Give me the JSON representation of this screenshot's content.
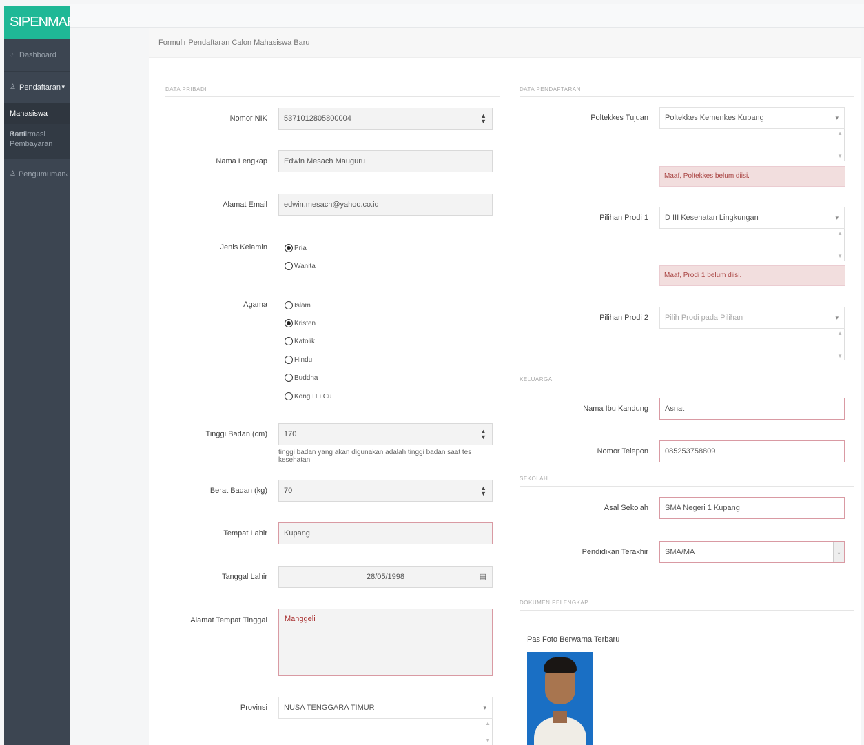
{
  "app": {
    "brand": "SIPENMARU"
  },
  "sidebar": {
    "dashboard": "Dashboard",
    "pendaftaran": "Pendaftaran",
    "sub_items": [
      "Mahasiswa Baru",
      "Konfirmasi Pembayaran"
    ],
    "pengumuman": "Pengumuman"
  },
  "panel": {
    "title": "Formulir Pendaftaran Calon Mahasiswa Baru"
  },
  "sections": {
    "data_pribadi": "DATA PRIBADI",
    "data_pendaftaran": "DATA PENDAFTARAN",
    "keluarga": "KELUARGA",
    "sekolah": "SEKOLAH",
    "dokumen": "DOKUMEN PELENGKAP"
  },
  "form": {
    "nik": {
      "label": "Nomor NIK",
      "value": "5371012805800004"
    },
    "nama": {
      "label": "Nama Lengkap",
      "value": "Edwin Mesach Mauguru"
    },
    "email": {
      "label": "Alamat Email",
      "value": "edwin.mesach@yahoo.co.id"
    },
    "jenis_kelamin": {
      "label": "Jenis Kelamin",
      "options": [
        "Pria",
        "Wanita"
      ],
      "selected": "Pria"
    },
    "agama": {
      "label": "Agama",
      "options": [
        "Islam",
        "Kristen",
        "Katolik",
        "Hindu",
        "Buddha",
        "Kong Hu Cu"
      ],
      "selected": "Kristen"
    },
    "tinggi": {
      "label": "Tinggi Badan (cm)",
      "value": "170",
      "help": "tinggi badan yang akan digunakan adalah tinggi badan saat tes kesehatan"
    },
    "berat": {
      "label": "Berat Badan (kg)",
      "value": "70"
    },
    "tempat_lahir": {
      "label": "Tempat Lahir",
      "value": "Kupang"
    },
    "tanggal_lahir": {
      "label": "Tanggal Lahir",
      "value": "28/05/1998"
    },
    "alamat": {
      "label": "Alamat Tempat Tinggal",
      "value": "Manggeli"
    },
    "provinsi": {
      "label": "Provinsi",
      "value": "NUSA TENGGARA TIMUR"
    }
  },
  "pendaftaran": {
    "poltekkes": {
      "label": "Poltekkes Tujuan",
      "value": "Poltekkes Kemenkes Kupang",
      "error": "Maaf, Poltekkes belum diisi."
    },
    "prodi1": {
      "label": "Pilihan Prodi 1",
      "value": "D III Kesehatan Lingkungan",
      "error": "Maaf, Prodi 1 belum diisi."
    },
    "prodi2": {
      "label": "Pilihan Prodi 2",
      "placeholder": "Pilih Prodi pada Pilihan"
    }
  },
  "keluarga": {
    "ibu": {
      "label": "Nama Ibu Kandung",
      "value": "Asnat"
    },
    "telepon": {
      "label": "Nomor Telepon",
      "value": "085253758809"
    }
  },
  "sekolah": {
    "asal": {
      "label": "Asal Sekolah",
      "value": "SMA Negeri 1 Kupang"
    },
    "pendidikan": {
      "label": "Pendidikan Terakhir",
      "value": "SMA/MA"
    }
  },
  "dokumen": {
    "pas_foto_label": "Pas Foto Berwarna Terbaru"
  },
  "icons": {
    "spinner": "spinner-arrows-icon",
    "calendar": "calendar-icon",
    "caret": "caret-down-icon"
  }
}
